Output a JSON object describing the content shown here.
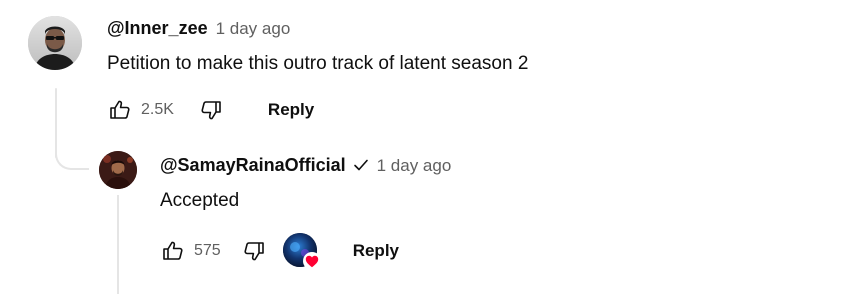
{
  "comment": {
    "author": "@Inner_zee",
    "time": "1 day ago",
    "text": "Petition to make this outro track of latent season 2",
    "likes": "2.5K",
    "reply_label": "Reply"
  },
  "reply": {
    "author": "@SamayRainaOfficial",
    "verified": true,
    "time": "1 day ago",
    "text": "Accepted",
    "likes": "575",
    "creator_heart": true,
    "reply_label": "Reply"
  },
  "icons": {
    "like": "thumbs-up-icon",
    "dislike": "thumbs-down-icon",
    "verified": "checkmark-icon",
    "heart": "heart-icon"
  },
  "colors": {
    "text_primary": "#0f0f0f",
    "text_secondary": "#606060",
    "heart": "#ff0033",
    "thread_line": "#e5e5e5"
  }
}
